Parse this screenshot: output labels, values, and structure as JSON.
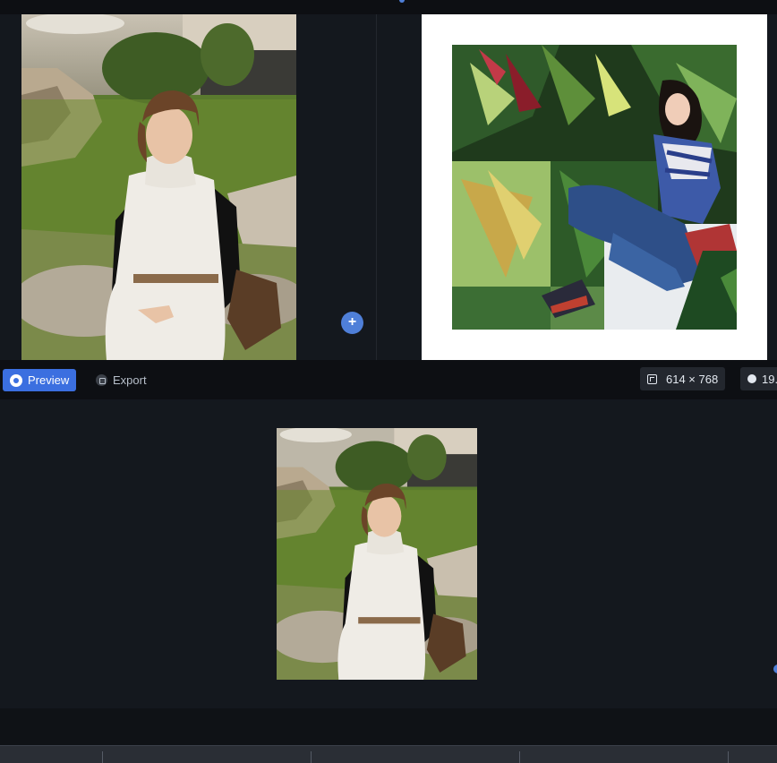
{
  "toolbar": {
    "preview_label": "Preview",
    "export_label": "Export",
    "size_label": "614 × 768",
    "time_label": "19.",
    "icons": {
      "preview": "eye-icon",
      "export": "export-icon",
      "size": "resize-icon",
      "time": "clock-icon"
    }
  },
  "canvas": {
    "add_label": "+"
  },
  "colors": {
    "accent": "#3b6fe0",
    "background": "#14181e",
    "toolbar": "#0d0f13",
    "badge": "#23272e"
  }
}
